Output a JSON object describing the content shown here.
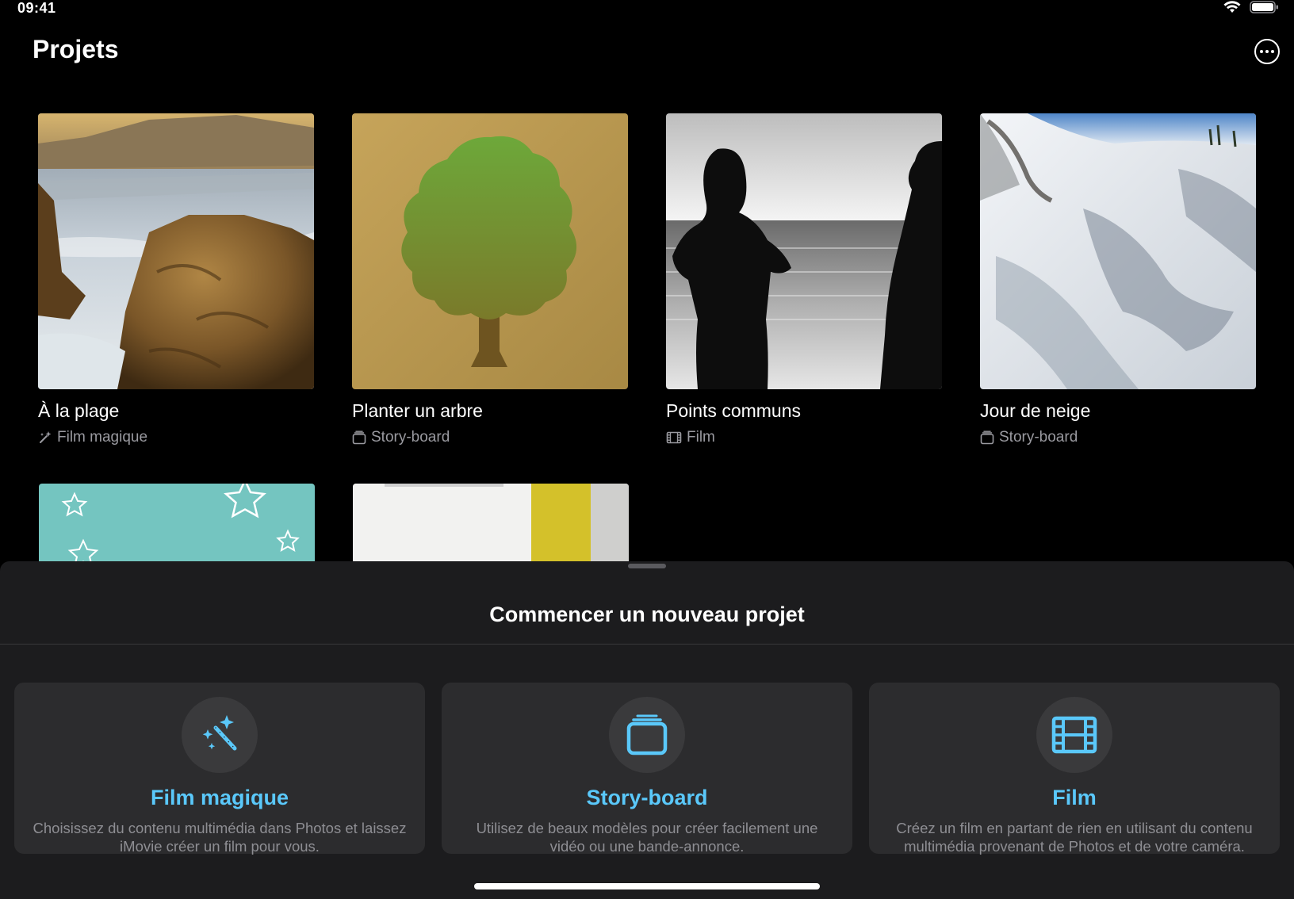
{
  "status_bar": {
    "time": "09:41"
  },
  "header": {
    "title": "Projets"
  },
  "projects": [
    {
      "title": "À la plage",
      "type": "Film magique",
      "type_icon": "magic-wand-icon"
    },
    {
      "title": "Planter un arbre",
      "type": "Story-board",
      "type_icon": "storyboard-icon"
    },
    {
      "title": "Points communs",
      "type": "Film",
      "type_icon": "film-icon"
    },
    {
      "title": "Jour de neige",
      "type": "Story-board",
      "type_icon": "storyboard-icon"
    }
  ],
  "new_project": {
    "title": "Commencer un nouveau projet",
    "options": [
      {
        "title": "Film magique",
        "description": "Choisissez du contenu multimédia dans Photos et laissez iMovie créer un film pour vous.",
        "icon": "magic-wand-icon"
      },
      {
        "title": "Story-board",
        "description": "Utilisez de beaux modèles pour créer facilement une vidéo ou une bande-annonce.",
        "icon": "storyboard-icon"
      },
      {
        "title": "Film",
        "description": "Créez un film en partant de rien en utilisant du contenu multimédia provenant de Photos et de votre caméra.",
        "icon": "film-icon"
      }
    ]
  },
  "colors": {
    "accent": "#5ac8fa",
    "background": "#000000",
    "sheet": "#1c1c1e",
    "card": "#2c2c2e"
  }
}
